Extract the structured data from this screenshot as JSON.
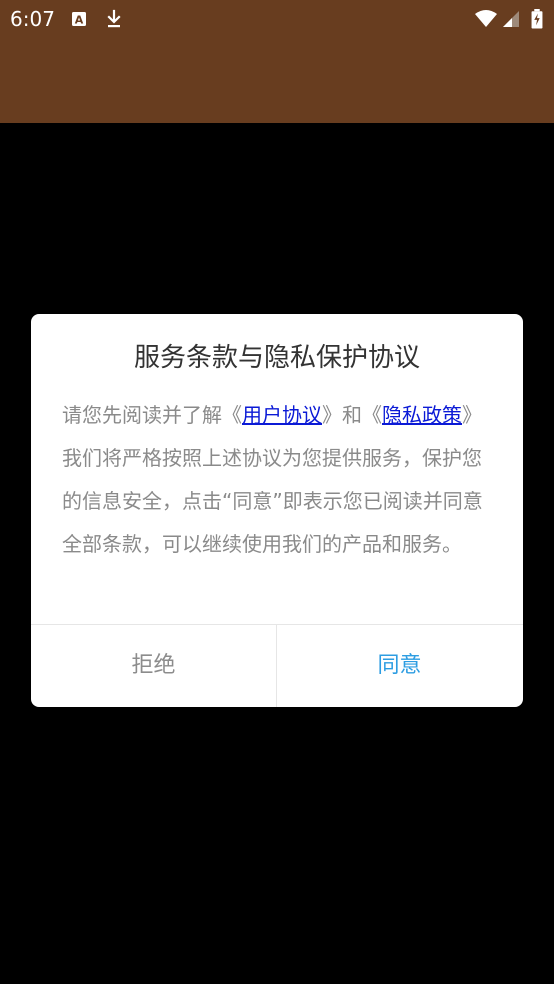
{
  "status_bar": {
    "time": "6:07",
    "bg_color": "#683d1f",
    "icons": [
      "app-a-icon",
      "download-icon",
      "wifi-icon",
      "signal-icon",
      "battery-icon"
    ]
  },
  "dialog": {
    "title": "服务条款与隐私保护协议",
    "body_prefix": "请您先阅读并了解《",
    "link_user_agreement": "用户协议",
    "body_middle": "》和《",
    "link_privacy_policy": "隐私政策",
    "body_suffix": "》我们将严格按照上述协议为您提供服务，保护您的信息安全，点击“同意”即表示您已阅读并同意全部条款，可以继续使用我们的产品和服务。",
    "reject_label": "拒绝",
    "accept_label": "同意",
    "link_color": "#0b1ad6",
    "accept_color": "#2d9de2"
  }
}
